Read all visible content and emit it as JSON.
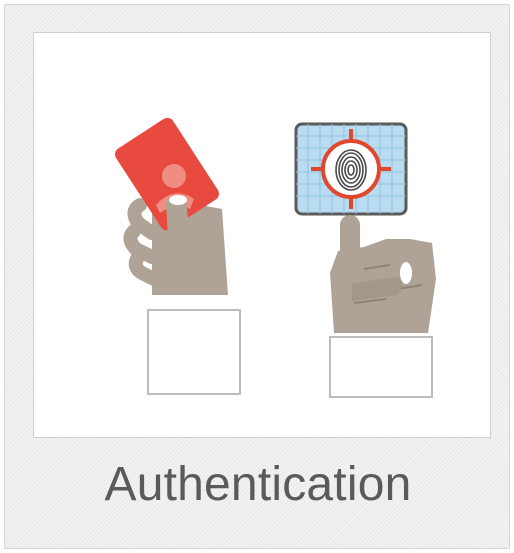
{
  "tile": {
    "caption": "Authentication"
  },
  "illustration": {
    "left_figure": "hand-holding-id-card",
    "right_figure": "finger-on-fingerprint-scanner",
    "colors": {
      "card": "#e84a3f",
      "skin": "#aea396",
      "scanner_screen": "#b9dcf0",
      "scanner_target": "#e0482e",
      "cuff": "#ffffff",
      "caption_text": "#5a5a5a"
    }
  }
}
